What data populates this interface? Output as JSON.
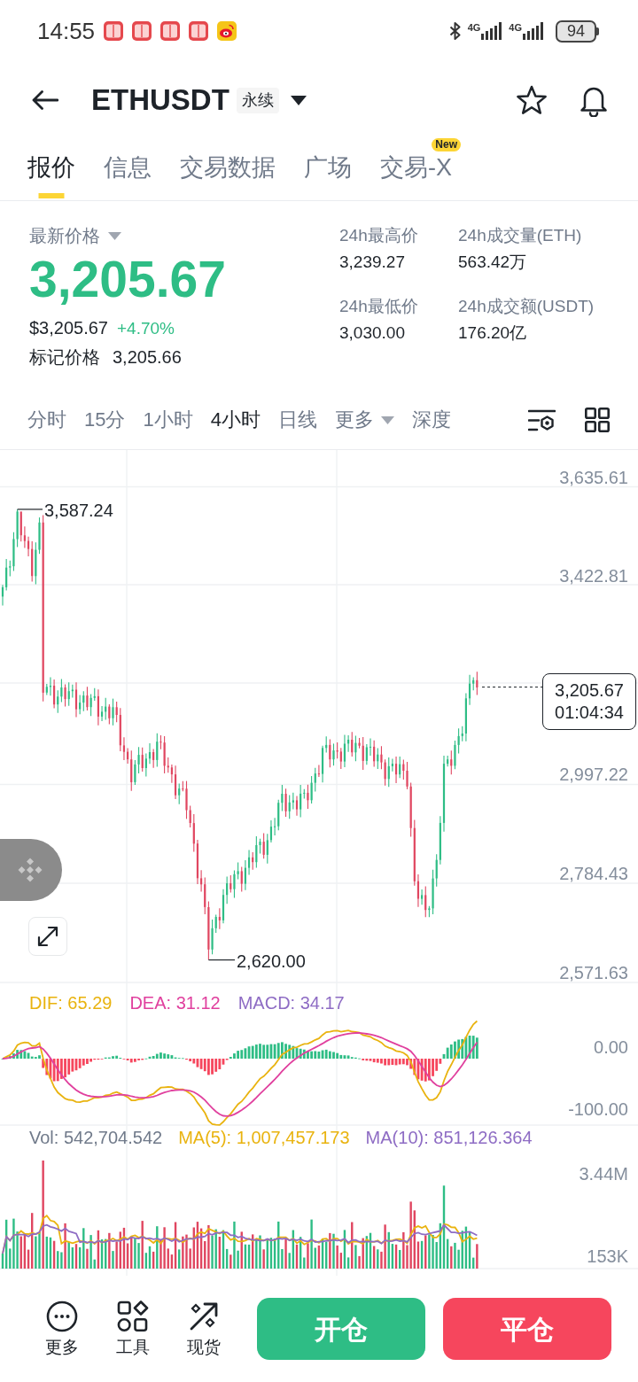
{
  "status_bar": {
    "time": "14:55",
    "networks": [
      "4G",
      "4G"
    ],
    "battery": "94"
  },
  "header": {
    "symbol": "ETHUSDT",
    "badge": "永续"
  },
  "tabs": [
    {
      "label": "报价",
      "selected": true
    },
    {
      "label": "信息",
      "selected": false
    },
    {
      "label": "交易数据",
      "selected": false
    },
    {
      "label": "广场",
      "selected": false
    },
    {
      "label": "交易-X",
      "selected": false,
      "badge": "New"
    }
  ],
  "ticker": {
    "label": "最新价格",
    "price": "3,205.67",
    "usd_price": "$3,205.67",
    "change": "+4.70%",
    "mark_label": "标记价格",
    "mark_price": "3,205.66"
  },
  "stats": [
    {
      "label": "24h最高价",
      "value": "3,239.27"
    },
    {
      "label": "24h成交量(ETH)",
      "value": "563.42万"
    },
    {
      "label": "24h最低价",
      "value": "3,030.00"
    },
    {
      "label": "24h成交额(USDT)",
      "value": "176.20亿"
    }
  ],
  "intervals": [
    {
      "label": "分时",
      "selected": false,
      "kind": "option"
    },
    {
      "label": "15分",
      "selected": false,
      "kind": "option"
    },
    {
      "label": "1小时",
      "selected": false,
      "kind": "option"
    },
    {
      "label": "4小时",
      "selected": true,
      "kind": "option"
    },
    {
      "label": "日线",
      "selected": false,
      "kind": "option"
    },
    {
      "label": "更多",
      "selected": false,
      "kind": "menu"
    },
    {
      "label": "深度",
      "selected": false,
      "kind": "option"
    }
  ],
  "price_chart": {
    "axis_labels": [
      "3,635.61",
      "3,422.81",
      "2,997.22",
      "2,784.43",
      "2,571.63"
    ],
    "high_label": "3,587.24",
    "low_label": "2,620.00",
    "last_price": "3,205.67",
    "countdown": "01:04:34"
  },
  "macd": {
    "legend": [
      {
        "text": "DIF: 65.29",
        "color": "#e9b30f"
      },
      {
        "text": "DEA: 31.12",
        "color": "#e0409e"
      },
      {
        "text": "MACD: 34.17",
        "color": "#8e6cc4"
      }
    ],
    "axis_labels": [
      "0.00",
      "-100.00"
    ]
  },
  "volume": {
    "legend": [
      {
        "text": "Vol: 542,704.542",
        "color": "#707a8a"
      },
      {
        "text": "MA(5): 1,007,457.173",
        "color": "#e9b30f"
      },
      {
        "text": "MA(10): 851,126.364",
        "color": "#8e6cc4"
      }
    ],
    "axis_labels": [
      "3.44M",
      "153K"
    ]
  },
  "bottom_bar": {
    "tools": [
      {
        "label": "更多"
      },
      {
        "label": "工具"
      },
      {
        "label": "现货"
      }
    ],
    "actions": [
      {
        "label": "开仓",
        "kind": "open"
      },
      {
        "label": "平仓",
        "kind": "close"
      }
    ]
  }
}
